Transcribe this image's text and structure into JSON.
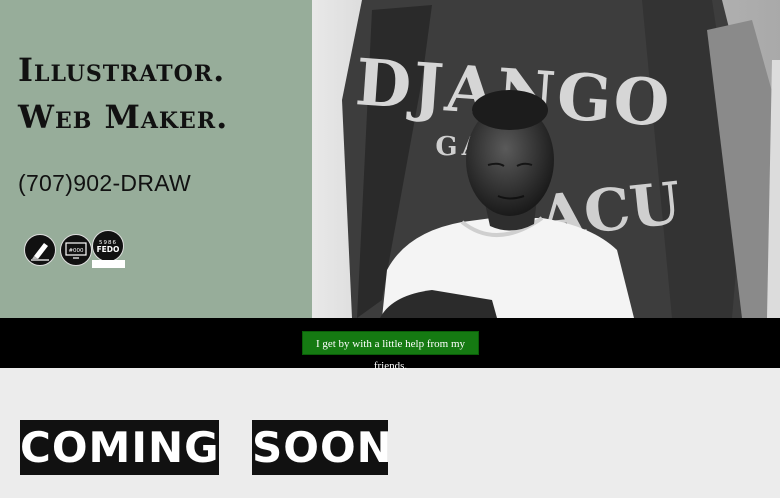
{
  "hero": {
    "title_line1": "Illustrator.",
    "title_line2": "Web Maker.",
    "phone": "(707)902-DRAW",
    "badges": [
      {
        "icon": "pen-nib-icon"
      },
      {
        "icon": "monitor-icon",
        "text": "#000"
      },
      {
        "icon": "fedo-badge-icon",
        "top": "5986",
        "bottom": "FEDO"
      }
    ],
    "photo": {
      "shirt_text_top": "DJANGO",
      "shirt_text_mid": "GA RA",
      "shirt_text_low": "ACU"
    }
  },
  "banner": {
    "button_label": "I get by with a little help from my friends."
  },
  "coming_soon": {
    "word1": "COMING",
    "word2": "SOON"
  },
  "colors": {
    "hero_left_bg": "#97ad9a",
    "banner_bg": "#000000",
    "button_bg": "#157a12",
    "page_bg": "#ececec"
  }
}
